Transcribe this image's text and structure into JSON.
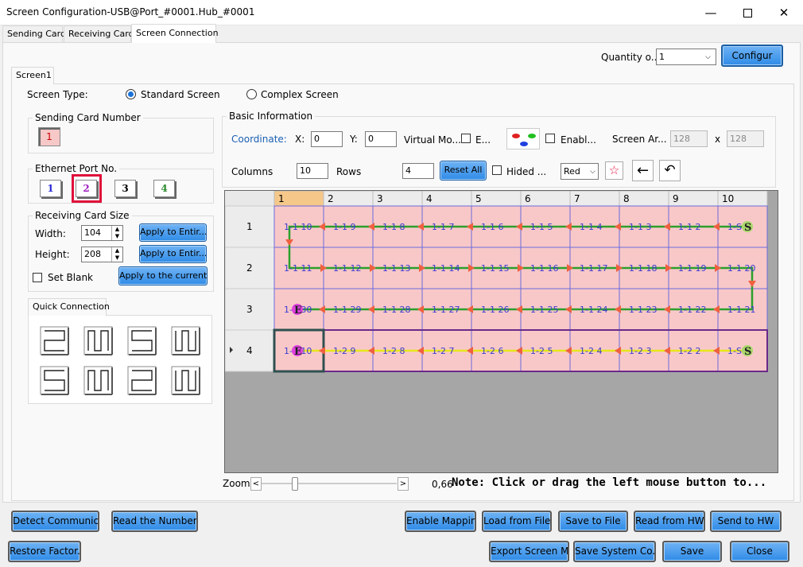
{
  "window": {
    "title": "Screen Configuration-USB@Port_#0001.Hub_#0001"
  },
  "tabs": [
    {
      "label": "Sending Card"
    },
    {
      "label": "Receiving Card"
    },
    {
      "label": "Screen Connection"
    }
  ],
  "top": {
    "quantity_label": "Quantity o...",
    "quantity_value": "1",
    "configure_label": "Configur"
  },
  "screen_tab": {
    "label": "Screen1"
  },
  "screen_type": {
    "label": "Screen Type:",
    "standard": "Standard Screen",
    "complex": "Complex Screen"
  },
  "sending_card": {
    "title": "Sending Card Number",
    "value": "1"
  },
  "ethernet": {
    "title": "Ethernet Port No.",
    "ports": [
      "1",
      "2",
      "3",
      "4"
    ],
    "port_colors": [
      "#2b2bd6",
      "#a020c0",
      "#000000",
      "#2e8b2e"
    ],
    "selected": "2"
  },
  "receiving_size": {
    "title": "Receiving Card Size",
    "width_label": "Width:",
    "width_value": "104",
    "height_label": "Height:",
    "height_value": "208",
    "apply_label": "Apply to Entir...",
    "set_blank": "Set Blank",
    "apply_current": "Apply to the current..."
  },
  "quick": {
    "title": "Quick Connection"
  },
  "basic": {
    "title": "Basic Information",
    "coordinate": "Coordinate:",
    "x_label": "X:",
    "x_value": "0",
    "y_label": "Y:",
    "y_value": "0",
    "virtual_mode": "Virtual Mo...",
    "e_label": "E...",
    "enable": "Enabl...",
    "screen_area": "Screen Ar...",
    "area_w": "128",
    "times": "x",
    "area_h": "128",
    "columns_label": "Columns",
    "columns_value": "10",
    "rows_label": "Rows",
    "rows_value": "4",
    "reset_all": "Reset All",
    "hided": "Hided ...",
    "color_value": "Red"
  },
  "grid": {
    "col_headers": [
      "1",
      "2",
      "3",
      "4",
      "5",
      "6",
      "7",
      "8",
      "9",
      "10"
    ],
    "row_headers": [
      "1",
      "2",
      "3",
      "4"
    ],
    "rows": [
      [
        "1-1 10",
        "1-1 9",
        "1-1 8",
        "1-1 7",
        "1-1 6",
        "1-1 5",
        "1-1 4",
        "1-1 3",
        "1-1 2",
        "1-S 1"
      ],
      [
        "1-1 11",
        "1-1 12",
        "1-1 13",
        "1-1 14",
        "1-1 15",
        "1-1 16",
        "1-1 17",
        "1-1 18",
        "1-1 19",
        "1-1 20"
      ],
      [
        "1-E 30",
        "1-1 29",
        "1-1 28",
        "1-1 27",
        "1-1 26",
        "1-1 25",
        "1-1 24",
        "1-1 23",
        "1-1 22",
        "1-1 21"
      ],
      [
        "1-E 10",
        "1-2 9",
        "1-2 8",
        "1-2 7",
        "1-2 6",
        "1-2 5",
        "1-2 4",
        "1-2 3",
        "1-2 2",
        "1-S 1"
      ]
    ],
    "path_colors": {
      "port1": "#2ca02c",
      "port2": "#e6e61a",
      "arrow": "#f06040"
    }
  },
  "zoom": {
    "label": "Zoom:",
    "left": "<",
    "right": ">",
    "value": "0,66",
    "note": "Note: Click or drag the left mouse button to..."
  },
  "buttons": {
    "detect": "Detect Communic...",
    "read_number": "Read the Number...",
    "enable_mapping": "Enable Mapping",
    "load_file": "Load from File",
    "save_file": "Save to File",
    "read_hw": "Read from HW",
    "send_hw": "Send to HW",
    "restore": "Restore Factor...",
    "export": "Export Screen M...",
    "save_system": "Save System Co...",
    "save": "Save",
    "close": "Close"
  }
}
